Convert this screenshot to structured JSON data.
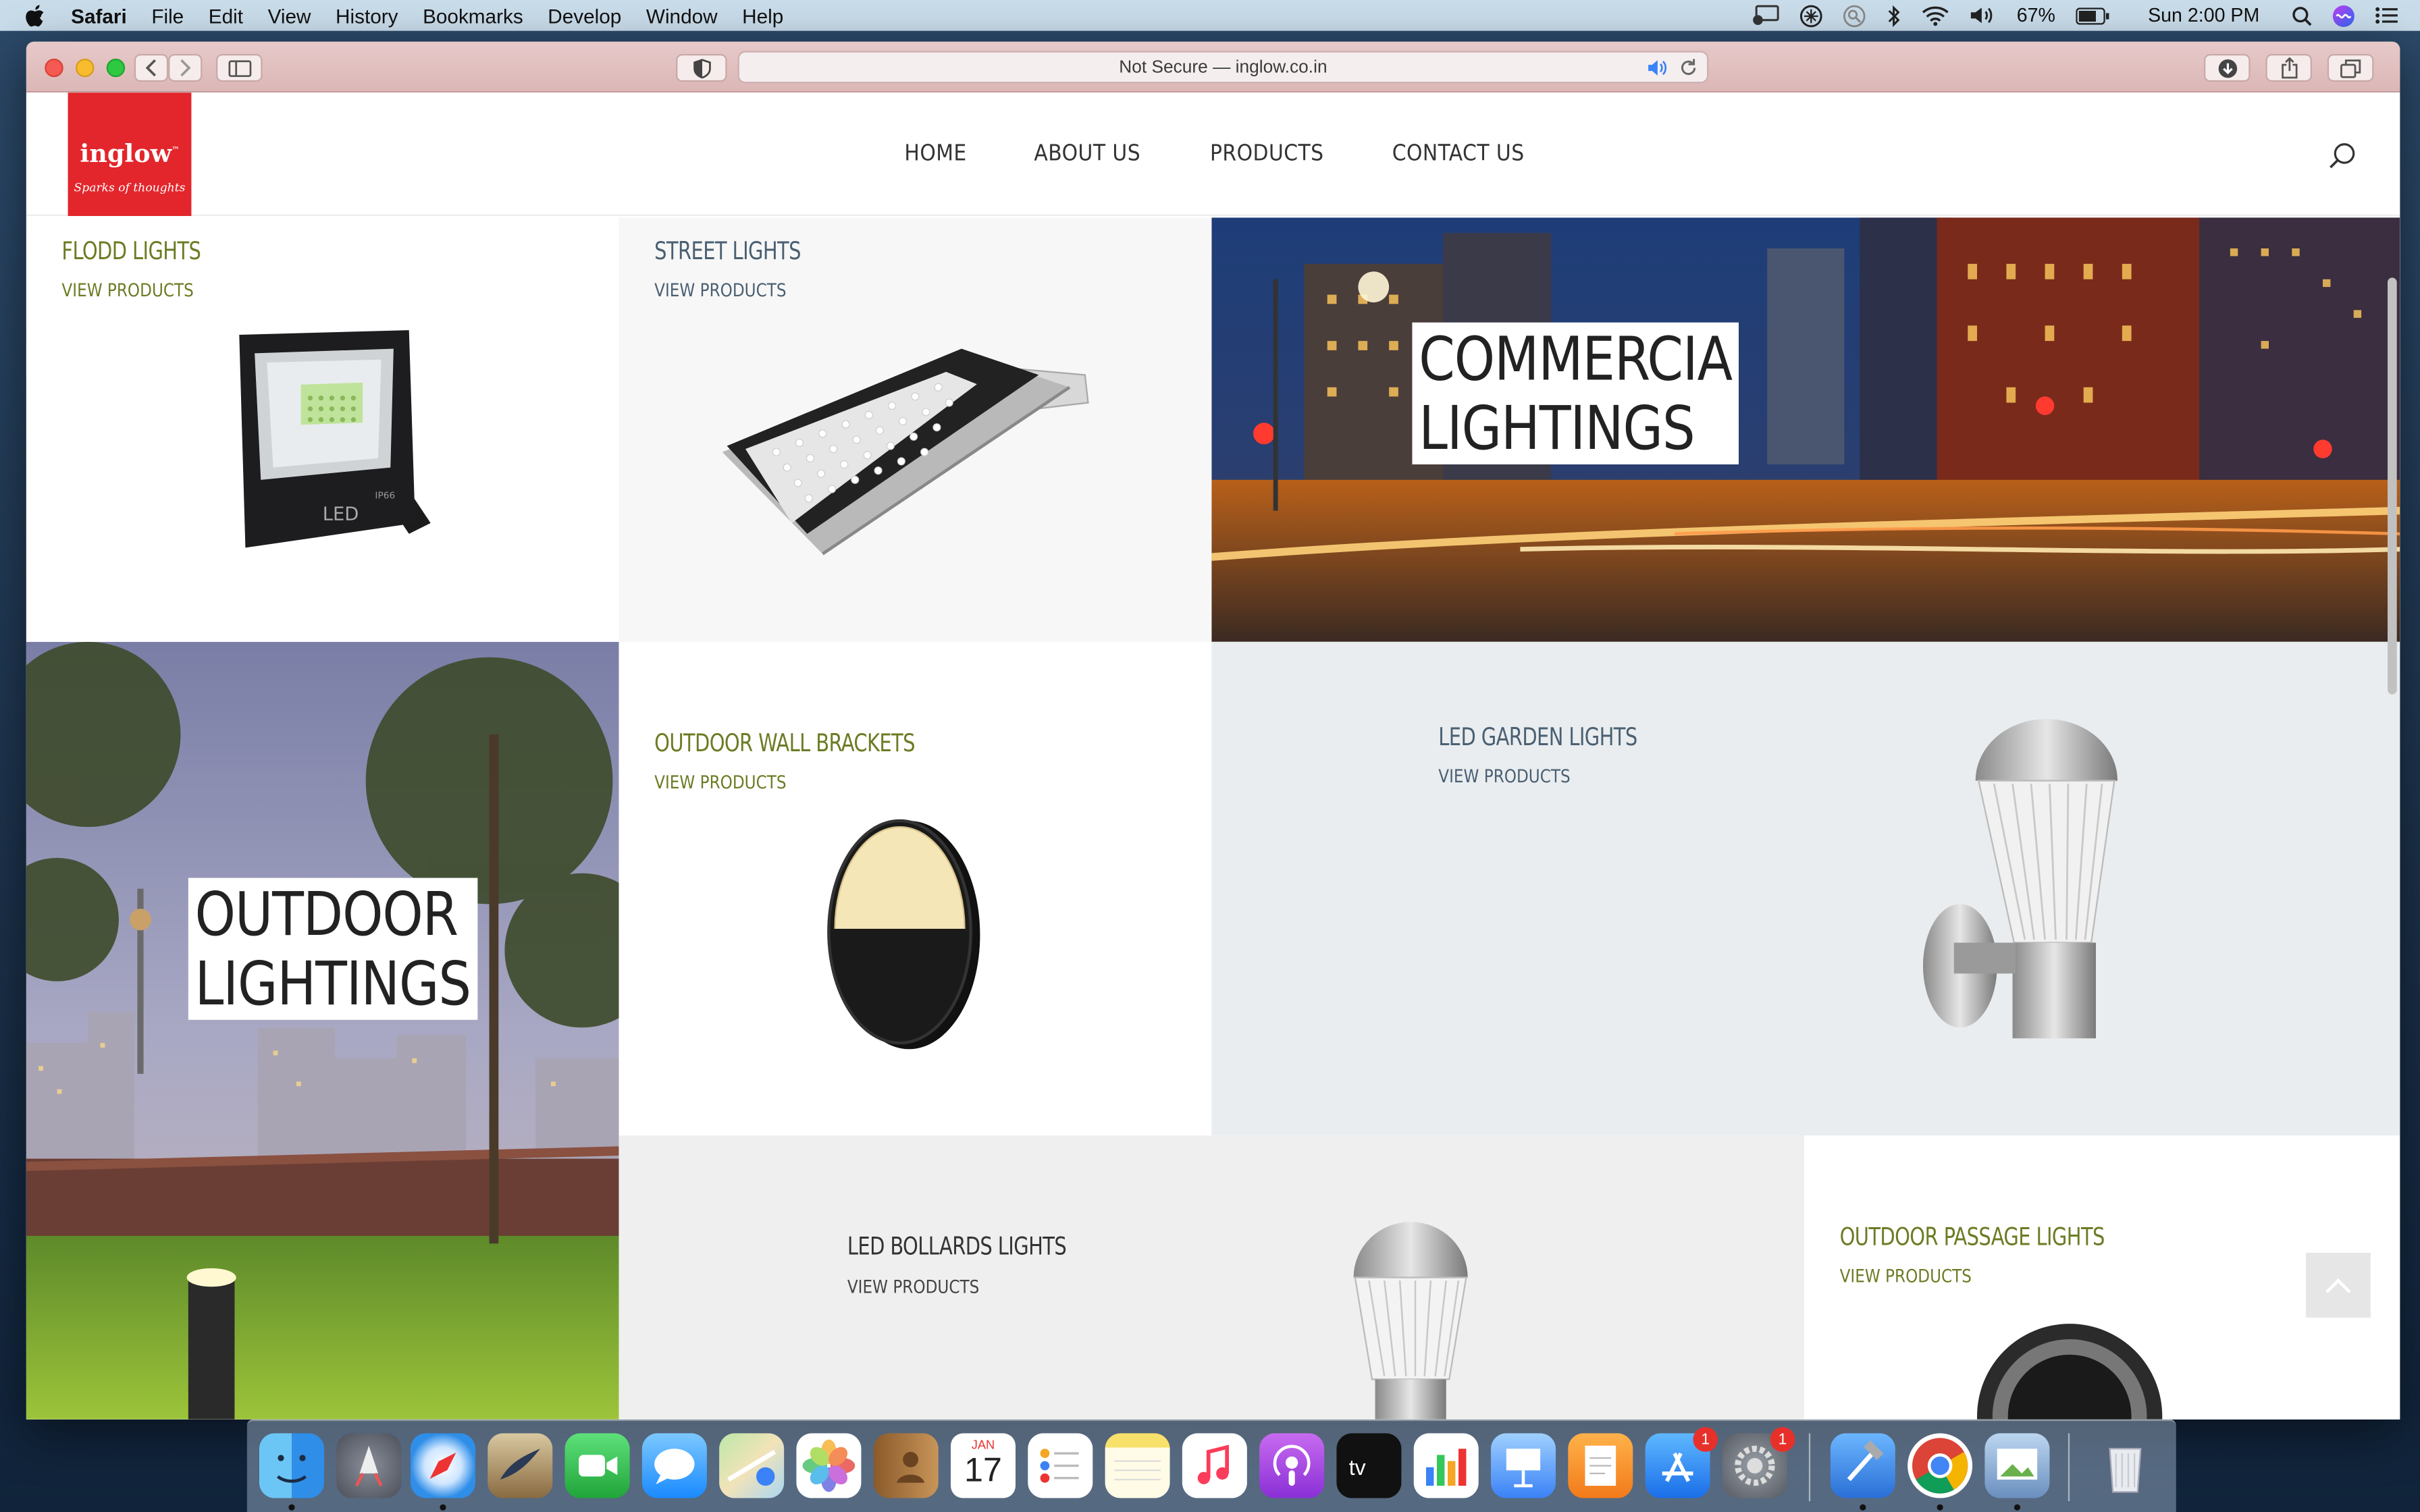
{
  "menubar": {
    "app_name": "Safari",
    "items": [
      "File",
      "Edit",
      "View",
      "History",
      "Bookmarks",
      "Develop",
      "Window",
      "Help"
    ],
    "battery": "67%",
    "clock": "Sun 2:00 PM"
  },
  "browser": {
    "url_text": "Not Secure — inglow.co.in"
  },
  "site": {
    "logo_name": "inglow",
    "logo_tm": "™",
    "logo_tagline": "Sparks of thoughts",
    "nav": [
      "HOME",
      "ABOUT US",
      "PRODUCTS",
      "CONTACT US"
    ],
    "tiles": {
      "flood": {
        "title": "FLODD LIGHTS",
        "link": "VIEW PRODUCTS"
      },
      "street": {
        "title": "STREET LIGHTS",
        "link": "VIEW PRODUCTS"
      },
      "commercial": {
        "line1": "COMMERCIA",
        "line2": "LIGHTINGS"
      },
      "outdoor": {
        "line1": "OUTDOOR",
        "line2": "LIGHTINGS"
      },
      "wall": {
        "title": "OUTDOOR WALL BRACKETS",
        "link": "VIEW PRODUCTS"
      },
      "garden": {
        "title": "LED GARDEN LIGHTS",
        "link": "VIEW PRODUCTS"
      },
      "bollards": {
        "title": "LED BOLLARDS LIGHTS",
        "link": "VIEW PRODUCTS"
      },
      "passage": {
        "title": "OUTDOOR PASSAGE LIGHTS",
        "link": "VIEW PRODUCTS"
      }
    },
    "flood_led_text": "LED",
    "flood_ip_text": "IP66"
  },
  "dock": {
    "calendar_month": "JAN",
    "calendar_day": "17",
    "appstore_badge": "1",
    "prefs_badge": "1"
  },
  "colors": {
    "green_title": "#6b7c24",
    "slate_title": "#4a5f72",
    "brand_red": "#e2262c"
  }
}
